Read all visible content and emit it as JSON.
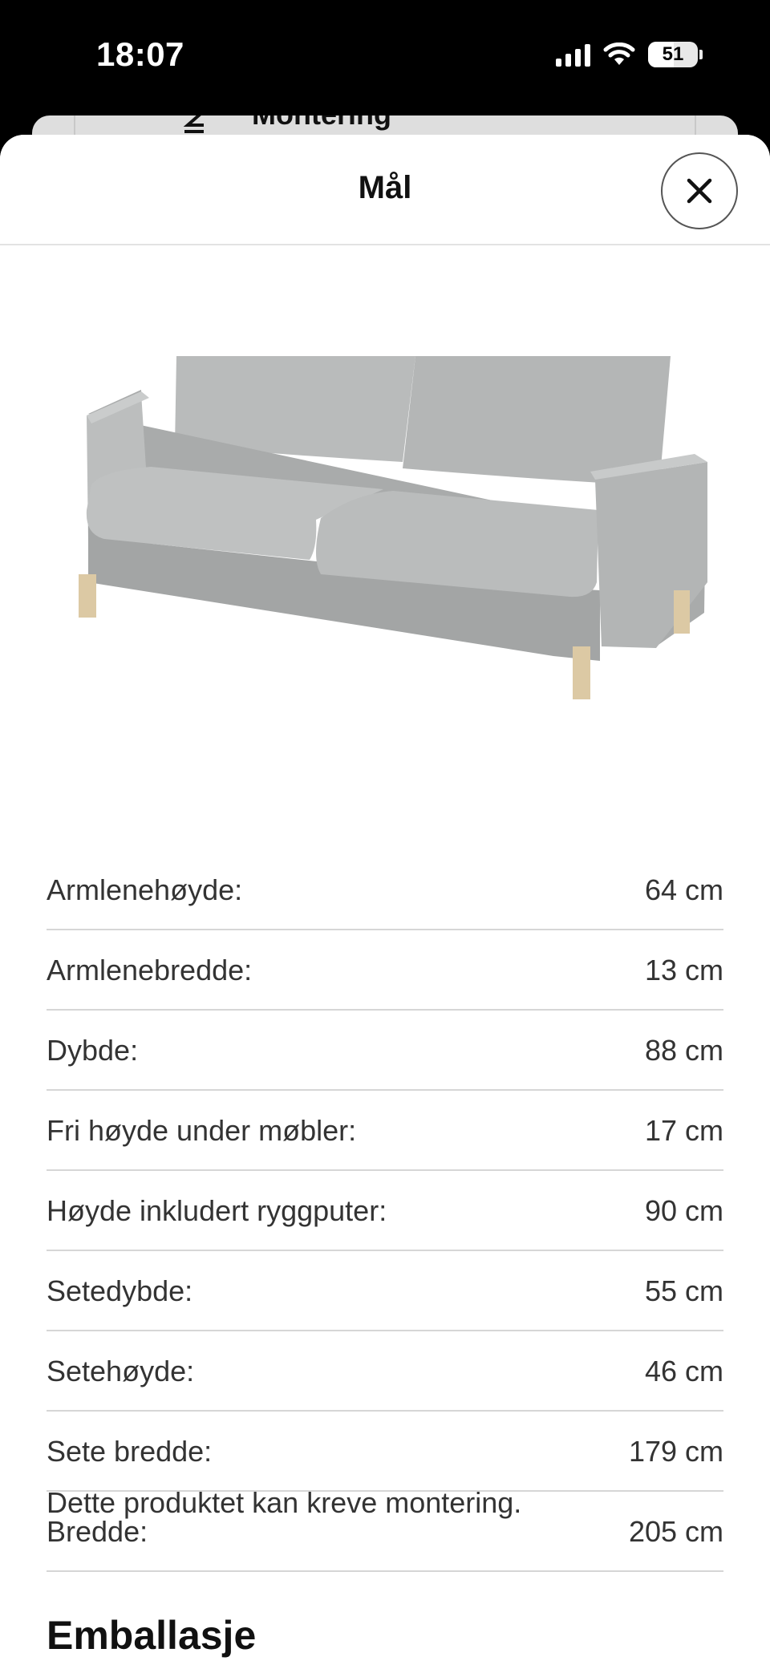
{
  "status_bar": {
    "time": "18:07",
    "battery": "51",
    "battery_level": 0.51,
    "icons": [
      "cellular-signal-icon",
      "wifi-icon",
      "battery-icon"
    ]
  },
  "background_card": {
    "label": "Montering",
    "icon": "assembly-icon"
  },
  "sheet": {
    "title": "Mål",
    "close_icon": "close-icon",
    "image": "sofa-product-image",
    "dimensions": [
      {
        "label": "Armlenehøyde:",
        "value": "64 cm"
      },
      {
        "label": "Armlenebredde:",
        "value": "13 cm"
      },
      {
        "label": "Dybde:",
        "value": "88 cm"
      },
      {
        "label": "Fri høyde under møbler:",
        "value": "17 cm"
      },
      {
        "label": "Høyde inkludert ryggputer:",
        "value": "90 cm"
      },
      {
        "label": "Setedybde:",
        "value": "55 cm"
      },
      {
        "label": "Setehøyde:",
        "value": "46 cm"
      },
      {
        "label": "Sete bredde:",
        "value": "179 cm"
      },
      {
        "label": "Bredde:",
        "value": "205 cm"
      }
    ],
    "note": "Dette produktet kan kreve montering.",
    "section_heading": "Emballasje"
  }
}
